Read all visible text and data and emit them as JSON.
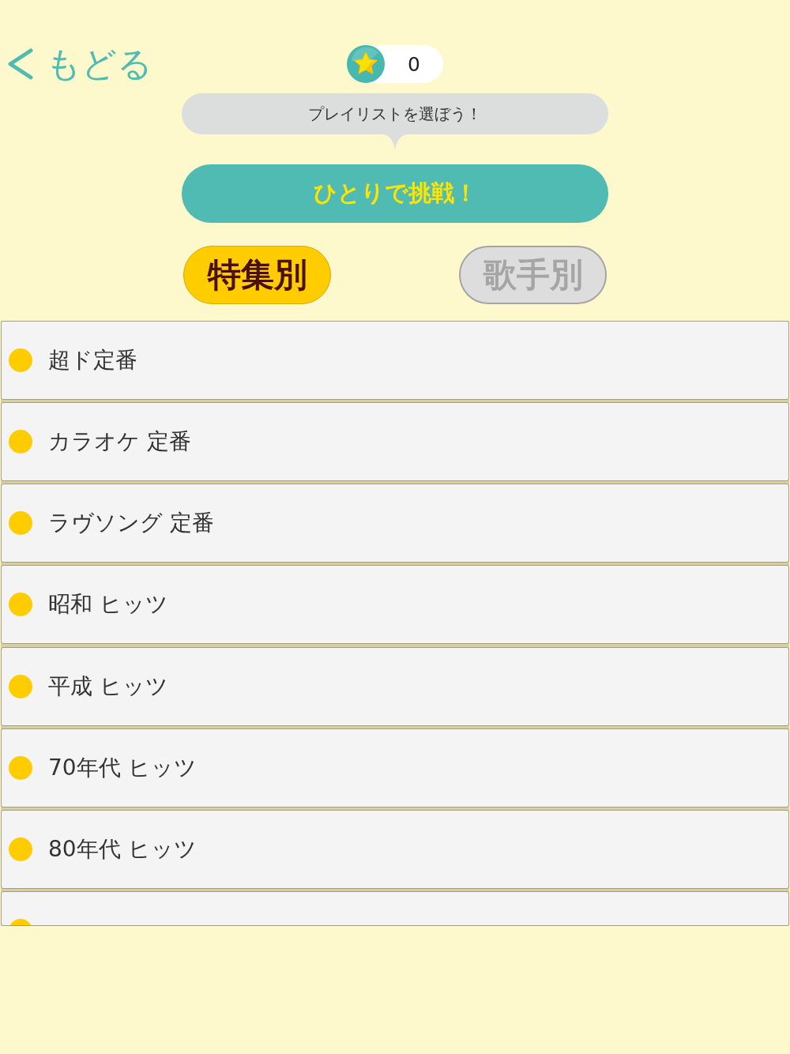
{
  "back_link": {
    "label": "もどる"
  },
  "score": {
    "value": "0"
  },
  "hint": {
    "text": "プレイリストを選ぼう！"
  },
  "solo_button": {
    "label": "ひとりで挑戦！"
  },
  "tabs": [
    {
      "label": "特集別",
      "selected": true
    },
    {
      "label": "歌手別",
      "selected": false
    }
  ],
  "playlists": [
    {
      "title": "超ド定番"
    },
    {
      "title": "カラオケ 定番"
    },
    {
      "title": "ラヴソング 定番"
    },
    {
      "title": "昭和 ヒッツ"
    },
    {
      "title": "平成 ヒッツ"
    },
    {
      "title": "70年代 ヒッツ"
    },
    {
      "title": "80年代 ヒッツ"
    }
  ]
}
